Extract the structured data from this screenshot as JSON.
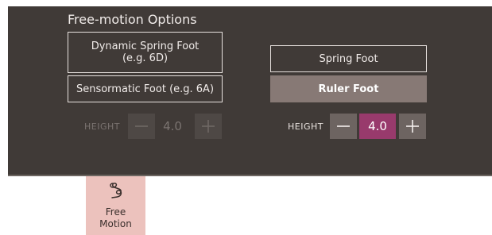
{
  "panel": {
    "title": "Free-motion Options",
    "options": {
      "dynamic_spring_foot": "Dynamic Spring Foot\n(e.g. 6D)",
      "sensormatic_foot": "Sensormatic Foot (e.g. 6A)",
      "spring_foot": "Spring Foot",
      "ruler_foot": "Ruler Foot"
    },
    "selected_option": "Ruler Foot",
    "height_left": {
      "label": "HEIGHT",
      "value": "4.0",
      "enabled": false
    },
    "height_right": {
      "label": "HEIGHT",
      "value": "4.0",
      "enabled": true
    }
  },
  "icons": {
    "minus": "minus-icon",
    "plus": "plus-icon",
    "free_motion": "free-motion-icon"
  },
  "colors": {
    "panel_background": "#403a37",
    "selected_option": "#877975",
    "height_value_active": "#983a6c",
    "tab_background": "#ecc2bd"
  },
  "tab": {
    "label": "Free\nMotion"
  }
}
